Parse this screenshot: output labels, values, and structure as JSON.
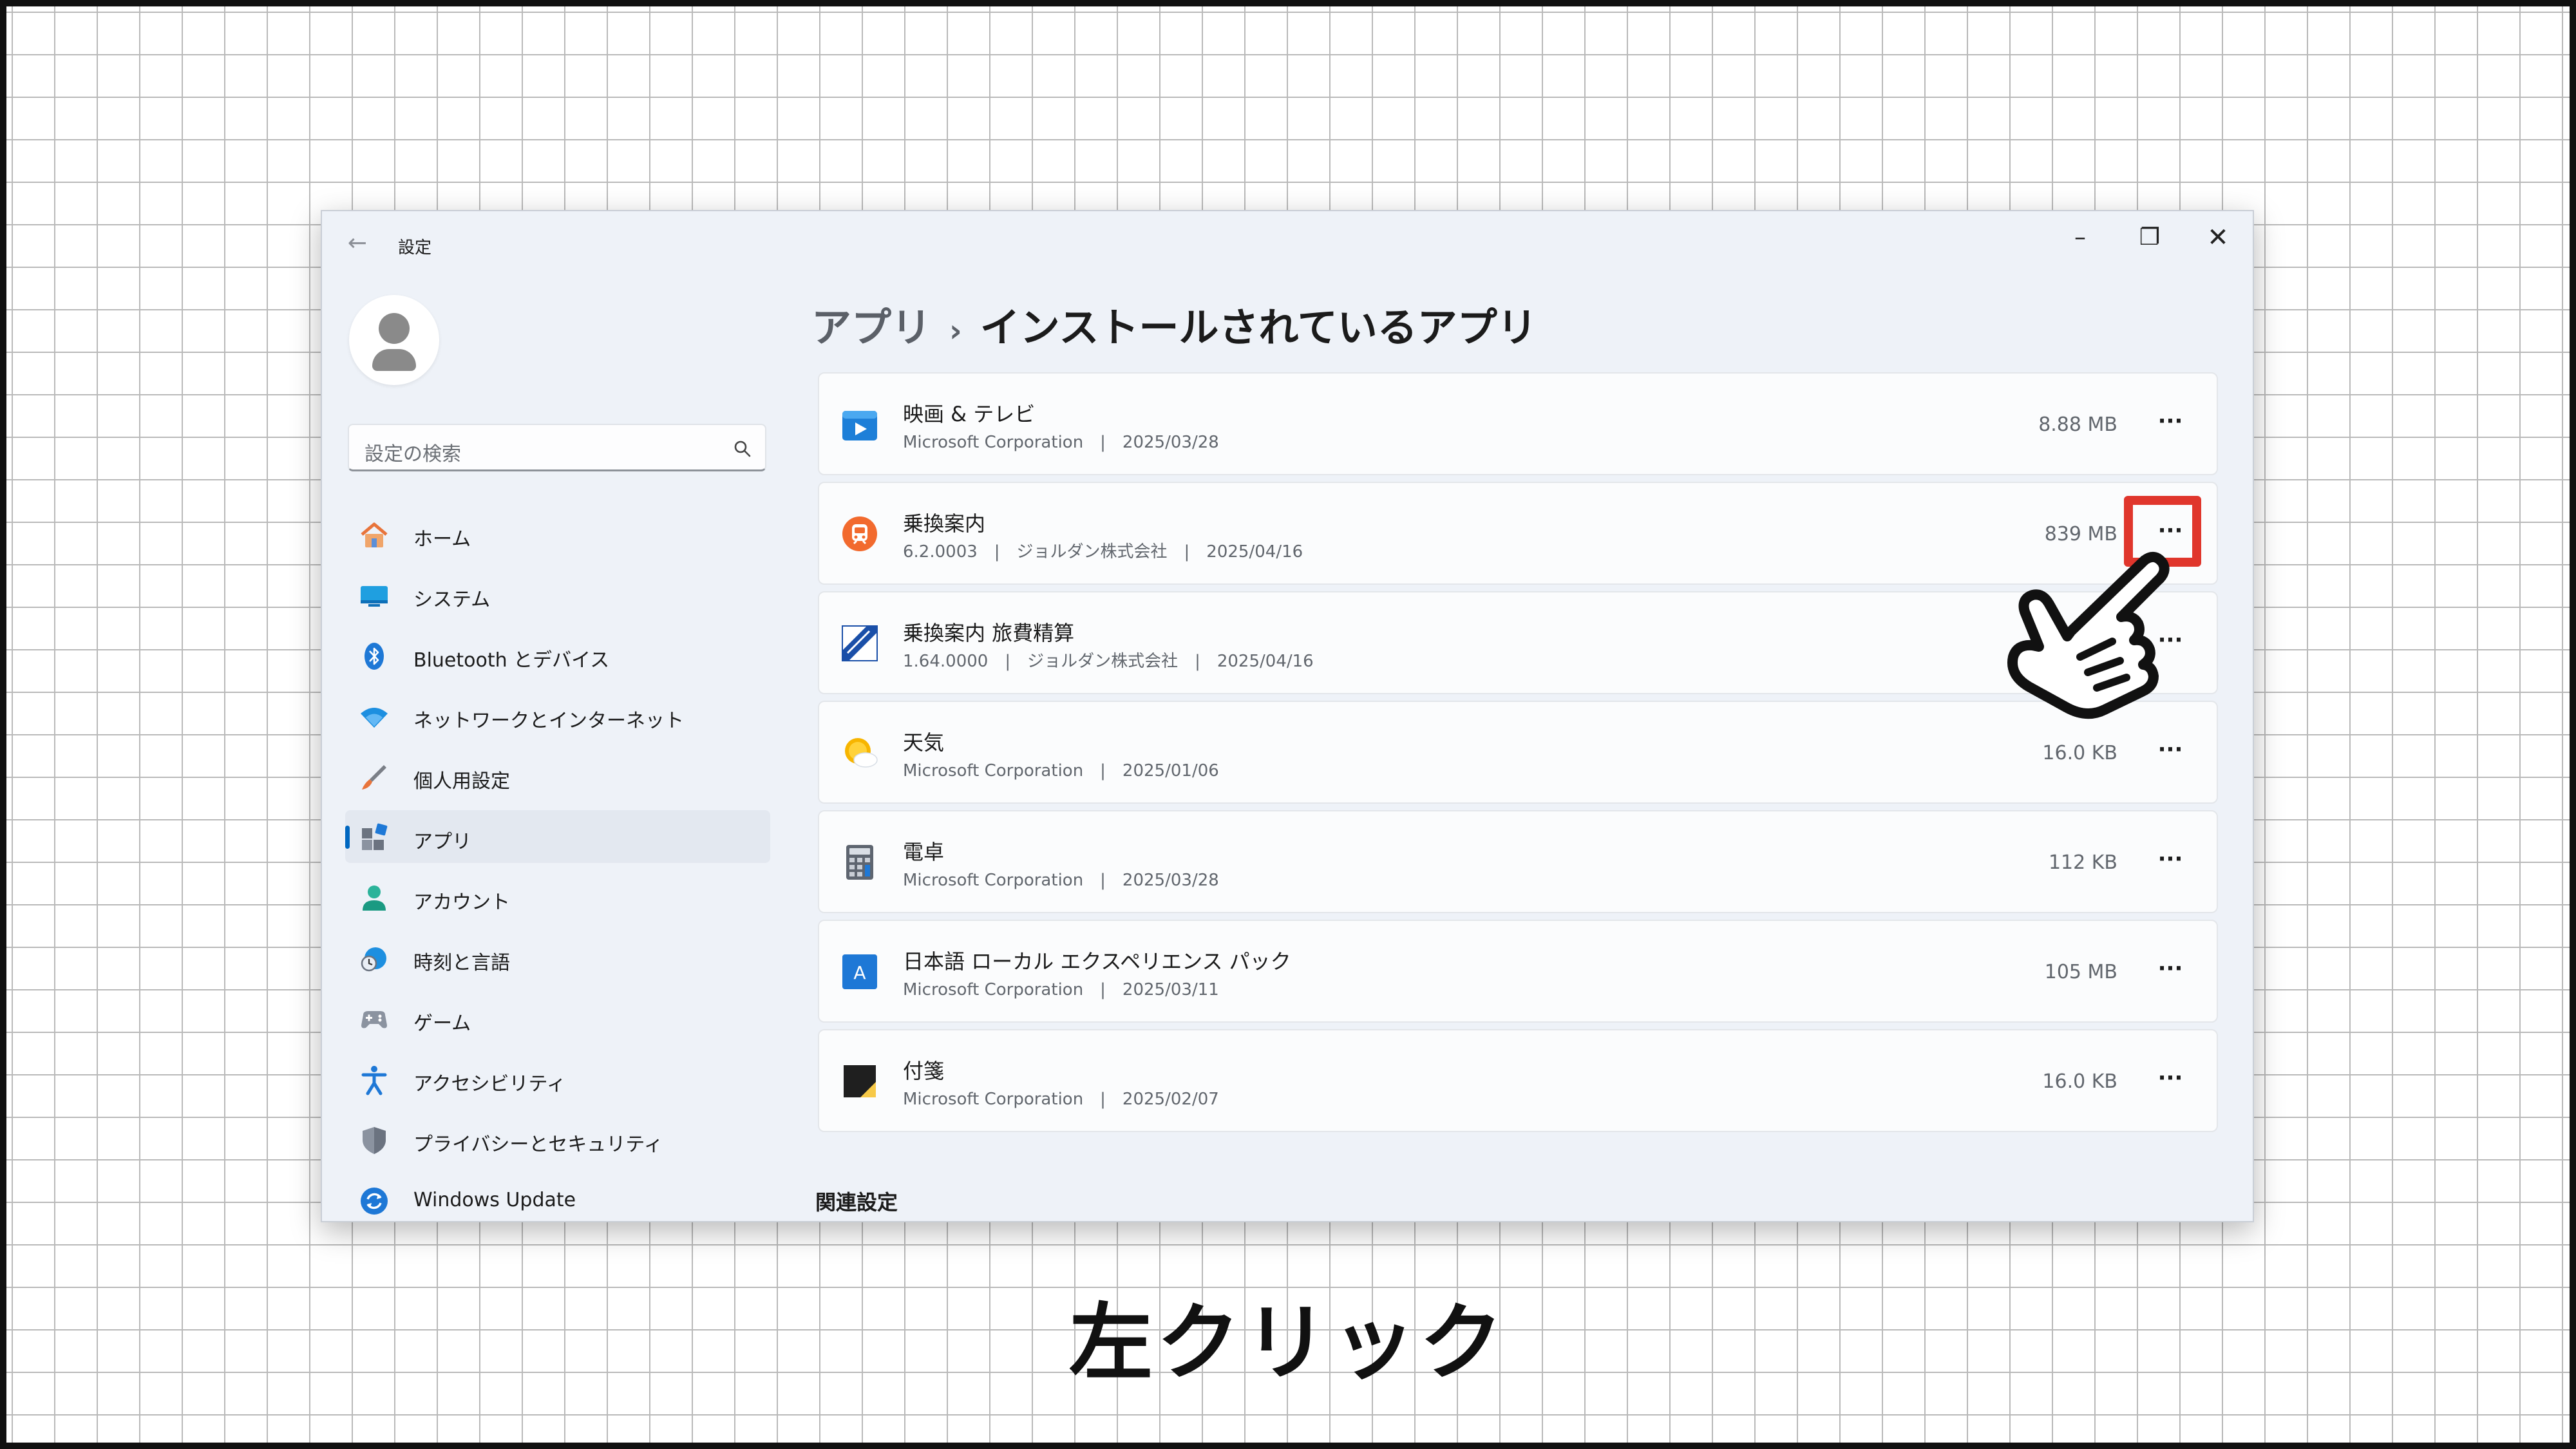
{
  "window": {
    "title": "設定",
    "controls": {
      "minimize": "–",
      "maximize": "❐",
      "close": "✕"
    }
  },
  "sidebar": {
    "search_placeholder": "設定の検索",
    "items": [
      {
        "label": "ホーム",
        "icon": "home-icon"
      },
      {
        "label": "システム",
        "icon": "system-icon"
      },
      {
        "label": "Bluetooth とデバイス",
        "icon": "bluetooth-icon"
      },
      {
        "label": "ネットワークとインターネット",
        "icon": "wifi-icon"
      },
      {
        "label": "個人用設定",
        "icon": "brush-icon"
      },
      {
        "label": "アプリ",
        "icon": "apps-icon",
        "active": true
      },
      {
        "label": "アカウント",
        "icon": "account-icon"
      },
      {
        "label": "時刻と言語",
        "icon": "clock-globe-icon"
      },
      {
        "label": "ゲーム",
        "icon": "gamepad-icon"
      },
      {
        "label": "アクセシビリティ",
        "icon": "accessibility-icon"
      },
      {
        "label": "プライバシーとセキュリティ",
        "icon": "shield-icon"
      },
      {
        "label": "Windows Update",
        "icon": "update-icon"
      }
    ]
  },
  "header": {
    "parent": "アプリ",
    "separator": "›",
    "current": "インストールされているアプリ"
  },
  "apps": [
    {
      "name": "映画 & テレビ",
      "meta": "Microsoft Corporation　|　2025/03/28",
      "size": "8.88 MB",
      "icon": "movies-tv-icon"
    },
    {
      "name": "乗換案内",
      "meta": "6.2.0003　|　ジョルダン株式会社　|　2025/04/16",
      "size": "839 MB",
      "icon": "train-icon"
    },
    {
      "name": "乗換案内 旅費精算",
      "meta": "1.64.0000　|　ジョルダン株式会社　|　2025/04/16",
      "size": "",
      "icon": "expense-icon"
    },
    {
      "name": "天気",
      "meta": "Microsoft Corporation　|　2025/01/06",
      "size": "16.0 KB",
      "icon": "weather-icon"
    },
    {
      "name": "電卓",
      "meta": "Microsoft Corporation　|　2025/03/28",
      "size": "112 KB",
      "icon": "calculator-icon"
    },
    {
      "name": "日本語 ローカル エクスペリエンス パック",
      "meta": "Microsoft Corporation　|　2025/03/11",
      "size": "105 MB",
      "icon": "language-pack-icon"
    },
    {
      "name": "付箋",
      "meta": "Microsoft Corporation　|　2025/02/07",
      "size": "16.0 KB",
      "icon": "sticky-notes-icon"
    }
  ],
  "more_label": "···",
  "related_settings": "関連設定",
  "caption": "左クリック",
  "colors": {
    "accent": "#0067c0",
    "highlight": "#e0362c"
  }
}
